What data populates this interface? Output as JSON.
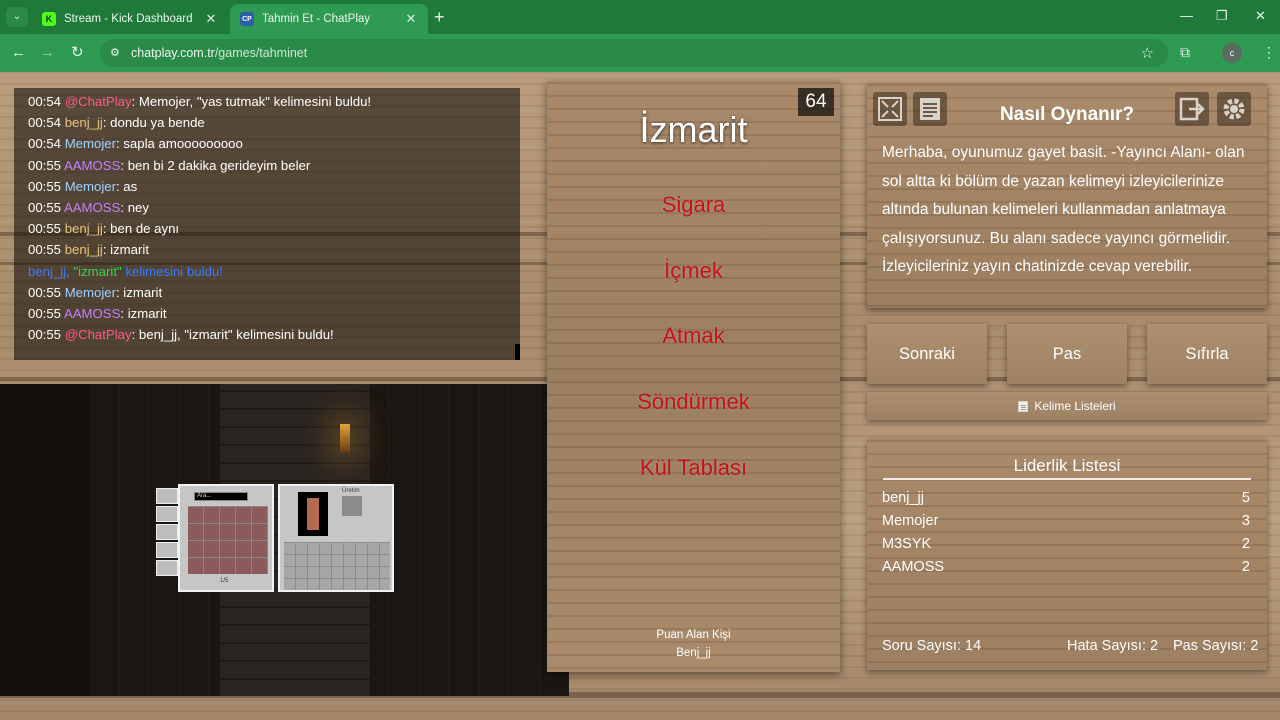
{
  "browser": {
    "tabs": [
      {
        "title": "Stream - Kick Dashboard",
        "favicon": "K"
      },
      {
        "title": "Tahmin Et - ChatPlay",
        "favicon": "CP"
      }
    ],
    "url_host": "chatplay.com.tr",
    "url_path": "/games/tahminet",
    "profile_initial": "c"
  },
  "chat": [
    {
      "time": "00:54",
      "user": "@ChatPlay",
      "color": "#ff5a8a",
      "msg": ": Memojer, \"yas tutmak\" kelimesini buldu!"
    },
    {
      "time": "00:54",
      "user": "benj_jj",
      "color": "#e8c27a",
      "msg": ": dondu ya bende"
    },
    {
      "time": "00:54",
      "user": "Memojer",
      "color": "#9fd0ff",
      "msg": ": sapla amooooooooo"
    },
    {
      "time": "00:55",
      "user": "AAMOSS",
      "color": "#c77dff",
      "msg": ": ben bi 2 dakika gerideyim beler"
    },
    {
      "time": "00:55",
      "user": "Memojer",
      "color": "#9fd0ff",
      "msg": ": as"
    },
    {
      "time": "00:55",
      "user": "AAMOSS",
      "color": "#c77dff",
      "msg": ": ney"
    },
    {
      "time": "00:55",
      "user": "benj_jj",
      "color": "#e8c27a",
      "msg": ": ben de aynı"
    },
    {
      "time": "00:55",
      "user": "benj_jj",
      "color": "#e8c27a",
      "msg": ": izmarit"
    },
    {
      "time": "00:55",
      "user": "Memojer",
      "color": "#9fd0ff",
      "msg": ": izmarit"
    },
    {
      "time": "00:55",
      "user": "AAMOSS",
      "color": "#c77dff",
      "msg": ": izmarit"
    },
    {
      "time": "00:55",
      "user": "@ChatPlay",
      "color": "#ff5a8a",
      "msg": ": benj_jj, \"izmarit\" kelimesini buldu!"
    }
  ],
  "chat_notice": {
    "pre": "benj_jj, ",
    "word": "\"izmarit\"",
    "post": " kelimesini buldu!"
  },
  "game_overlay": {
    "search_text": "Ara...",
    "page": "1/5",
    "craft_label": "Üretim"
  },
  "board": {
    "timer": "64",
    "word": "İzmarit",
    "taboo": [
      "Sigara",
      "İçmek",
      "Atmak",
      "Söndürmek",
      "Kül Tablası"
    ],
    "scorer_label": "Puan Alan Kişi",
    "scorer_name": "Benj_jj"
  },
  "howto": {
    "title": "Nasıl Oynanır?",
    "text": "Merhaba, oyunumuz gayet basit. -Yayıncı Alanı- olan sol altta ki bölüm de yazan kelimeyi izleyicilerinize altında bulunan kelimeleri kullanmadan anlatmaya çalışıyorsunuz. Bu alanı sadece yayıncı görmelidir. İzleyicileriniz yayın chatinizde cevap verebilir."
  },
  "buttons": {
    "next": "Sonraki",
    "pass": "Pas",
    "reset": "Sıfırla",
    "word_lists": "Kelime Listeleri"
  },
  "leaderboard": {
    "title": "Liderlik Listesi",
    "rows": [
      {
        "name": "benj_jj",
        "score": "5"
      },
      {
        "name": "Memojer",
        "score": "3"
      },
      {
        "name": "M3SYK",
        "score": "2"
      },
      {
        "name": "AAMOSS",
        "score": "2"
      }
    ],
    "question_count": "Soru Sayısı: 14",
    "error_count": "Hata Sayısı: 2",
    "pass_count": "Pas Sayısı: 2"
  }
}
